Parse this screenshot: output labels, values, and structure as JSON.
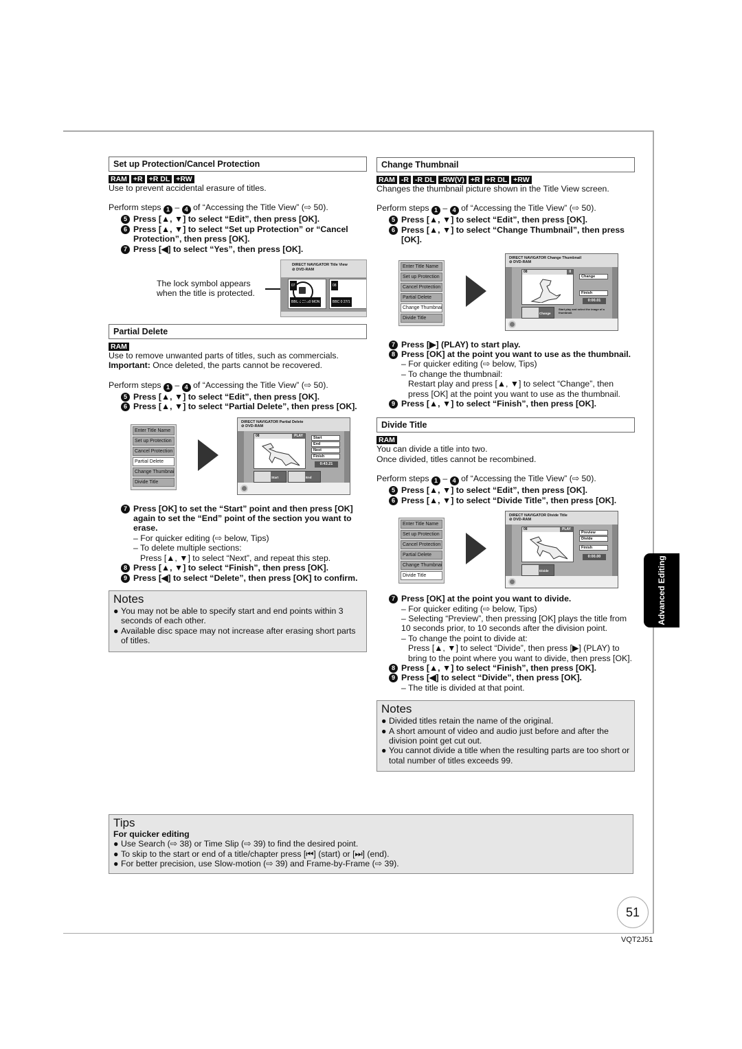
{
  "badge_colors": {
    "bg": "#111111",
    "fg": "#ffffff"
  },
  "sections": {
    "protection": {
      "title": "Set up Protection/Cancel Protection",
      "badges": [
        "RAM",
        "+R",
        "+R DL",
        "+RW"
      ],
      "description": "Use to prevent accidental erasure of titles.",
      "perform": {
        "prefix": "Perform steps",
        "from": "1",
        "to": "4",
        "suffix": "of “Accessing the Title View” (⇨ 50)."
      },
      "steps": [
        {
          "num": "5",
          "text": "Press [▲, ▼] to select “Edit”, then press [OK]."
        },
        {
          "num": "6",
          "text": "Press [▲, ▼] to select “Set up Protection” or “Cancel Protection”, then press [OK]."
        },
        {
          "num": "7",
          "text": "Press [◀] to select “Yes”, then press [OK]."
        }
      ],
      "figure": {
        "caption": "The lock symbol appears when the title is protected.",
        "screen_title": "DIRECT NAVIGATOR    Title View",
        "screen_disc": "DVD-RAM",
        "cells": [
          {
            "num": "07",
            "date": "BBC 0 27/10 MON"
          },
          {
            "num": "08",
            "date": "BBC 0 27/1"
          }
        ]
      }
    },
    "partial_delete": {
      "title": "Partial Delete",
      "badges": [
        "RAM"
      ],
      "description": "Use to remove unwanted parts of titles, such as commercials.",
      "important_label": "Important:",
      "important_text": " Once deleted, the parts cannot be recovered.",
      "perform": {
        "prefix": "Perform steps",
        "from": "1",
        "to": "4",
        "suffix": "of “Accessing the Title View” (⇨ 50)."
      },
      "steps_a": [
        {
          "num": "5",
          "text": "Press [▲, ▼] to select “Edit”, then press [OK]."
        },
        {
          "num": "6",
          "text": "Press [▲, ▼] to select “Partial Delete”, then press [OK]."
        }
      ],
      "figure": {
        "menu": [
          "Enter Title Name",
          "Set up Protection",
          "Cancel Protection",
          "Partial Delete",
          "Change Thumbnail",
          "Divide Title"
        ],
        "selected": "Partial Delete",
        "screen_title": "DIRECT NAVIGATOR    Partial Delete",
        "screen_disc": "DVD-RAM",
        "mode": "VIDEO",
        "title_num": "08",
        "state": "PLAY",
        "options": [
          "Start",
          "End",
          "Next",
          "Finish"
        ],
        "time": "0:43.21",
        "thumb_labels": [
          "Start",
          "End"
        ]
      },
      "steps_b": [
        {
          "num": "7",
          "text": "Press [OK] to set the “Start” point and then press [OK] again to set the “End” point of the section you want to erase."
        }
      ],
      "subs": [
        "– For quicker editing (⇨ below, Tips)",
        "– To delete multiple sections:"
      ],
      "sub_detail": "Press [▲, ▼] to select “Next”, and repeat this step.",
      "steps_c": [
        {
          "num": "8",
          "text": "Press [▲, ▼] to select “Finish”, then press [OK]."
        },
        {
          "num": "9",
          "text": "Press [◀] to select “Delete”, then press [OK] to confirm."
        }
      ],
      "notes_title": "Notes",
      "notes": [
        "You may not be able to specify start and end points within 3 seconds of each other.",
        "Available disc space may not increase after erasing short parts of titles."
      ]
    },
    "change_thumbnail": {
      "title": "Change Thumbnail",
      "badges": [
        "RAM",
        "-R",
        "-R DL",
        "-RW(V)",
        "+R",
        "+R DL",
        "+RW"
      ],
      "description": "Changes the thumbnail picture shown in the Title View screen.",
      "perform": {
        "prefix": "Perform steps",
        "from": "1",
        "to": "4",
        "suffix": "of “Accessing the Title View” (⇨ 50)."
      },
      "steps_a": [
        {
          "num": "5",
          "text": "Press [▲, ▼] to select “Edit”, then press [OK]."
        },
        {
          "num": "6",
          "text": "Press [▲, ▼] to select “Change Thumbnail”, then press [OK]."
        }
      ],
      "figure": {
        "menu": [
          "Enter Title Name",
          "Set up Protection",
          "Cancel Protection",
          "Partial Delete",
          "Change Thumbnail",
          "Divide Title"
        ],
        "selected": "Change Thumbnail",
        "screen_title": "DIRECT NAVIGATOR    Change Thumbnail",
        "screen_disc": "DVD-RAM",
        "mode": "VIDEO",
        "title_num": "08",
        "state": "II",
        "options": [
          "Change",
          "Finish"
        ],
        "time": "0:00.01",
        "thumb_labels": [
          "Change"
        ],
        "hint": "Start play and select the image of a thumbnail."
      },
      "steps_b": [
        {
          "num": "7",
          "text": "Press [▶] (PLAY) to start play."
        },
        {
          "num": "8",
          "text": "Press [OK] at the point you want to use as the thumbnail."
        }
      ],
      "subs": [
        "– For quicker editing (⇨ below, Tips)",
        "– To change the thumbnail:"
      ],
      "sub_detail": "Restart play and press [▲, ▼] to select “Change”, then press [OK] at the point you want to use as the thumbnail.",
      "steps_c": [
        {
          "num": "9",
          "text": "Press [▲, ▼] to select “Finish”, then press [OK]."
        }
      ]
    },
    "divide_title": {
      "title": "Divide Title",
      "badges": [
        "RAM"
      ],
      "description_1": "You can divide a title into two.",
      "description_2": "Once divided, titles cannot be recombined.",
      "perform": {
        "prefix": "Perform steps",
        "from": "1",
        "to": "4",
        "suffix": "of “Accessing the Title View” (⇨ 50)."
      },
      "steps_a": [
        {
          "num": "5",
          "text": "Press [▲, ▼] to select “Edit”, then press [OK]."
        },
        {
          "num": "6",
          "text": "Press [▲, ▼] to select “Divide Title”, then press [OK]."
        }
      ],
      "figure": {
        "menu": [
          "Enter Title Name",
          "Set up Protection",
          "Cancel Protection",
          "Partial Delete",
          "Change Thumbnail",
          "Divide Title"
        ],
        "selected": "Divide Title",
        "screen_title": "DIRECT NAVIGATOR    Divide Title",
        "screen_disc": "DVD-RAM",
        "mode": "VIDEO",
        "title_num": "08",
        "state": "PLAY",
        "options": [
          "Preview",
          "Divide",
          "Finish"
        ],
        "time": "0:00.00",
        "thumb_labels": [
          "Divide"
        ]
      },
      "steps_b": [
        {
          "num": "7",
          "text": "Press [OK] at the point you want to divide."
        }
      ],
      "subs": [
        "– For quicker editing (⇨ below, Tips)",
        "– Selecting “Preview”, then pressing [OK] plays the title from 10 seconds prior, to 10 seconds after the division point.",
        "– To change the point to divide at:"
      ],
      "sub_detail": "Press [▲, ▼] to select “Divide”, then press [▶] (PLAY) to bring to the point where you want to divide, then press [OK].",
      "steps_c": [
        {
          "num": "8",
          "text": "Press [▲, ▼] to select “Finish”, then press [OK]."
        },
        {
          "num": "9",
          "text": "Press [◀] to select “Divide”, then press [OK]."
        }
      ],
      "after": "– The title is divided at that point.",
      "notes_title": "Notes",
      "notes": [
        "Divided titles retain the name of the original.",
        "A short amount of video and audio just before and after the division point get cut out.",
        "You cannot divide a title when the resulting parts are too short or total number of titles exceeds 99."
      ]
    }
  },
  "tips": {
    "title": "Tips",
    "subtitle": "For quicker editing",
    "items": [
      "Use Search (⇨ 38) or Time Slip (⇨ 39) to find the desired point.",
      "To skip to the start or end of a title/chapter press [⏮] (start) or [⏭] (end).",
      "For better precision, use Slow-motion (⇨ 39) and Frame-by-Frame (⇨ 39)."
    ]
  },
  "side_tab": "Advanced Editing",
  "page_number": "51",
  "doc_code": "VQT2J51"
}
